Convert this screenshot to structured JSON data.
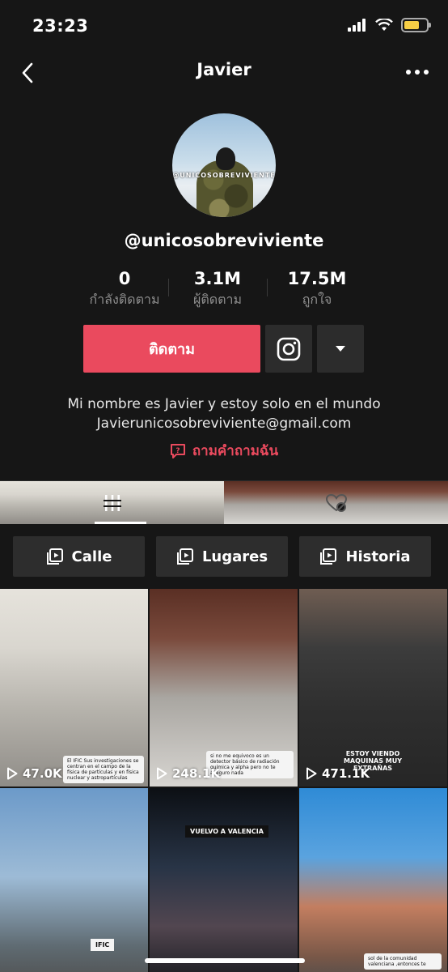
{
  "status_bar": {
    "time": "23:23"
  },
  "header": {
    "title": "Javier"
  },
  "profile": {
    "avatar_text": "@UNICOSOBREVIVIENTE",
    "username": "@unicosobreviviente",
    "stats": [
      {
        "value": "0",
        "label": "กำลังติดตาม"
      },
      {
        "value": "3.1M",
        "label": "ผู้ติดตาม"
      },
      {
        "value": "17.5M",
        "label": "ถูกใจ"
      }
    ],
    "follow_label": "ติดตาม",
    "bio_line1": "Mi nombre es Javier y estoy solo en el mundo",
    "bio_line2": "Javierunicosobreviviente@gmail.com",
    "ask_label": "ถามคำถามฉัน"
  },
  "playlists": [
    {
      "label": "Calle"
    },
    {
      "label": "Lugares"
    },
    {
      "label": "Historia"
    }
  ],
  "videos": [
    {
      "views": "47.0K",
      "caption": "El IFIC Sus investigaciones se centran en el campo de la física de partículas y en física nuclear y astropartículas"
    },
    {
      "views": "248.1K",
      "caption": "si no me equivoco es un detector básico de radiación química y alpha pero no te aseguro nada"
    },
    {
      "views": "471.1K",
      "overlay": "ESTOY VIENDO MAQUINAS MUY EXTRAÑAS"
    },
    {
      "overlay": "IFIC"
    },
    {
      "overlay": "VUELVO A VALENCIA"
    },
    {
      "caption": "sol de la comunidad valenciana ,entonces te"
    }
  ],
  "colors": {
    "accent": "#ea4a5e",
    "background": "#161616",
    "chip": "#2d2d2d"
  },
  "icons": [
    "back-icon",
    "more-icon",
    "instagram-icon",
    "caret-down-icon",
    "question-icon",
    "grid-icon",
    "liked-hidden-icon",
    "playlist-icon",
    "play-icon"
  ]
}
